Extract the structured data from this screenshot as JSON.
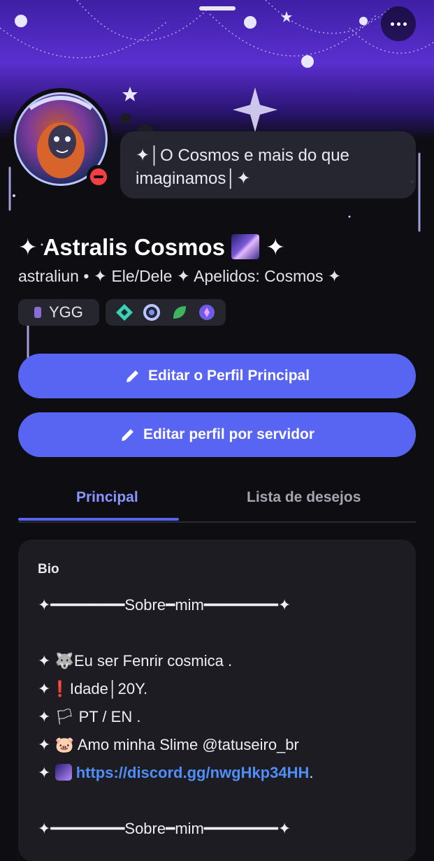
{
  "profile": {
    "status_text": "✦│O Cosmos e mais do que imaginamos│✦",
    "display_name_prefix": "✦ Astralis Cosmos",
    "display_name_suffix": "✦",
    "username": "astraliun",
    "separator": "•",
    "pronouns_and_nick": "✦ Ele/Dele ✦ Apelidos: Cosmos ✦",
    "server_tag": "YGG",
    "badges": [
      "hypesquad-balance-icon",
      "nitro-laurel-icon",
      "leaf-icon",
      "quest-orb-icon"
    ]
  },
  "buttons": {
    "edit_main": "Editar o Perfil Principal",
    "edit_server": "Editar perfil por servidor"
  },
  "tabs": {
    "main": "Principal",
    "wishlist": "Lista de desejos"
  },
  "bio": {
    "title": "Bio",
    "line1": "✦━━━━━━━━Sobre━mim━━━━━━━━✦",
    "line2": "✦ 🐺Eu ser Fenrir cosmica .",
    "line3": "✦❗Idade│20Y.",
    "line4": "✦ 🏳 PT /  EN .",
    "line5": "✦ 🐷 Amo minha Slime @tatuseiro_br",
    "line6_prefix": "✦",
    "line6_link": "https://discord.gg/nwgHkp34HH",
    "line6_suffix": ".",
    "line7": "✦━━━━━━━━Sobre━mim━━━━━━━━✦"
  },
  "colors": {
    "accent": "#5865f2",
    "dnd": "#f23f43",
    "link": "#4f8ef7"
  }
}
